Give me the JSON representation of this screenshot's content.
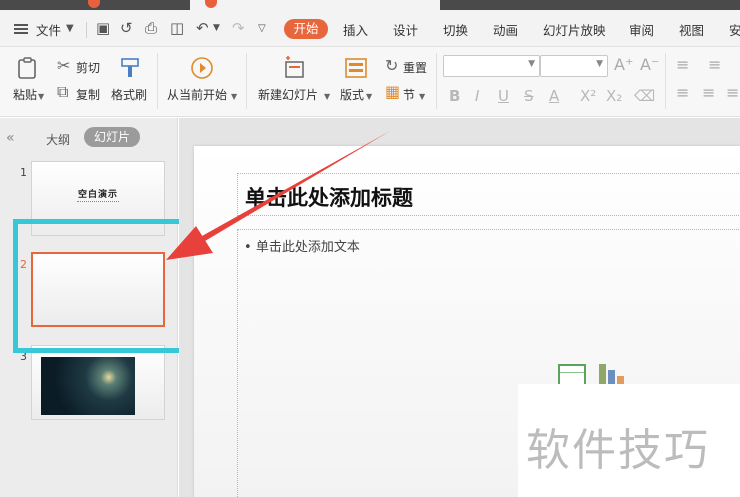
{
  "menu": {
    "file_label": "文件",
    "tabs": [
      "开始",
      "插入",
      "设计",
      "切换",
      "动画",
      "幻灯片放映",
      "审阅",
      "视图",
      "安"
    ]
  },
  "ribbon": {
    "paste_label": "粘贴",
    "cut_label": "剪切",
    "copy_label": "复制",
    "format_painter_label": "格式刷",
    "play_from_current_label": "从当前开始",
    "new_slide_label": "新建幻灯片",
    "layout_label": "版式",
    "reset_label": "重置",
    "section_label": "节"
  },
  "left_panel": {
    "outline_tab": "大纲",
    "slides_tab": "幻灯片",
    "thumbnails": [
      {
        "number": "1",
        "title": "空白演示"
      },
      {
        "number": "2",
        "title": ""
      },
      {
        "number": "3",
        "title": ""
      }
    ]
  },
  "slide": {
    "title_placeholder": "单击此处添加标题",
    "body_placeholder": "单击此处添加文本"
  },
  "watermark": "软件技巧",
  "colors": {
    "accent": "#e7663b",
    "highlight": "#37c8d7",
    "arrow": "#e8413b"
  }
}
